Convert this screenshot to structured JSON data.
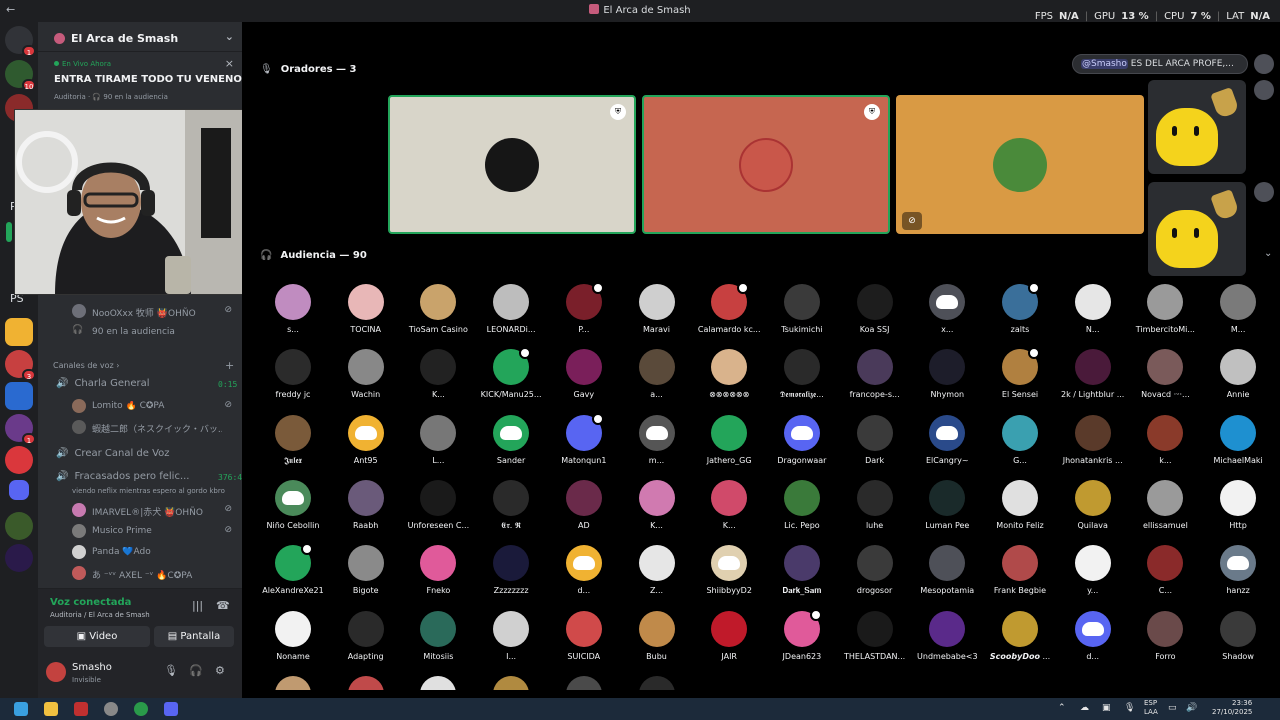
{
  "window": {
    "title": "El Arca de Smash",
    "back_icon": "arrow-left-icon"
  },
  "stats": {
    "fps_label": "FPS",
    "fps": "N/A",
    "gpu_label": "GPU",
    "gpu": "13 %",
    "cpu_label": "CPU",
    "cpu": "7 %",
    "lat_label": "LAT",
    "lat": "N/A"
  },
  "rail": {
    "badges": [
      "1",
      "10",
      "1",
      "3",
      "1"
    ],
    "ps_label": "PS",
    "pd_label": "PD"
  },
  "sidebar": {
    "server_name": "El Arca de Smash",
    "stage": {
      "live_label": "En Vivo Ahora",
      "title": "ENTRA TIRAME TODO TU VENENO",
      "sub": "Auditoria · 🎧 90 en la audiencia"
    },
    "stage_members": [
      {
        "name": "NooOXxx 牧师 👹OHÑO"
      },
      {
        "name": "90 en la audiencia"
      }
    ],
    "voice_category": "Canales de voz",
    "channels": [
      {
        "name": "Charla General",
        "time": "0:15",
        "members": [
          "Lomito 🔥 C✪PA",
          "蝦越二郎（ネスクイック・バッ..."
        ]
      },
      {
        "name": "Crear Canal de Voz"
      },
      {
        "name": "Fracasados pero felic...",
        "time": "376:49:39",
        "status": "viendo neflix mientras espero al gordo kbro",
        "members": [
          "IMARVEL®|赤犬 👹OHÑO",
          "Musico Prime",
          "Panda 💙Ado",
          "あ ⁻ᵛᵛ AXEL ⁻ᵛ 🔥C✪PA"
        ]
      }
    ],
    "voice": {
      "connected": "Voz conectada",
      "where": "Auditoria / El Arca de Smash",
      "video_label": "Video",
      "screen_label": "Pantalla"
    },
    "user": {
      "name": "Smasho",
      "status": "Invisible"
    }
  },
  "main": {
    "speakers_label": "Oradores — 3",
    "audience_label": "Audiencia — 90",
    "chat_mention": "@Smasho",
    "chat_text": " ES DEL ARCA PROFE,...",
    "speaker_tiles": [
      {
        "color": "#d8d5c9",
        "badge": true,
        "muted": false
      },
      {
        "color": "#c66650",
        "badge": true,
        "muted": false
      },
      {
        "color": "#d99a44",
        "badge": false,
        "muted": true
      }
    ],
    "audience": [
      "s...",
      "TOCINA",
      "TioSam Casino",
      "LEONARDi...",
      "P...",
      "Maravi",
      "Calamardo kc...",
      "Tsukimichi",
      "Koa SSJ",
      "x...",
      "zalts",
      "N...",
      "TimbercitoMi...",
      "M...",
      "freddy jc",
      "Wachin",
      "K...",
      "KICK/Manu25...",
      "Gavy",
      "a...",
      "⊗⊗⊗⊗⊗⊗",
      "𝕯𝖊𝖒𝖔𝖗𝖆𝖑𝖎𝖟𝖊...",
      "francope-s...",
      "Nhymon",
      "El Sensei",
      "2k / Lightblur ...",
      "Novacd ·ᵕ·...",
      "Annie",
      "𝕵𝖚𝖑𝖊𝖝",
      "Ant95",
      "L...",
      "Sander",
      "Matonqun1",
      "m...",
      "Jathero_GG",
      "Dragonwaar",
      "Dark",
      "ElCangry~",
      "G...",
      "Jhonatankris ...",
      "k...",
      "MichaelMaki",
      "Niño Cebollin",
      "Raabh",
      "Unforeseen C...",
      "𝕰𝖗. 𝕽",
      "AD",
      "K...",
      "K...",
      "Lic. Pepo",
      "luhe",
      "Luman Pee",
      "Monito Feliz",
      "Quilava",
      "ellissamuel",
      "Http",
      "AleXandreXe21",
      "Bigote",
      "Fneko",
      "Zzzzzzzz",
      "d...",
      "Z...",
      "ShiibbyyD2",
      "𝐃𝐚𝐫𝐤_𝐒𝐚𝐦",
      "drogosor",
      "Mesopotamia",
      "Frank Begbie",
      "y...",
      "C...",
      "hanzz",
      "Noname",
      "Adapting",
      "Mitosiis",
      "I...",
      "SUICIDA",
      "Bubu",
      "JAIR",
      "JDean623",
      "THELASTDAN...",
      "Undmebabe<3",
      "𝙎𝙘𝙤𝙤𝙗𝙮𝘿𝙤𝙤 ...",
      "d...",
      "Forro",
      "Shadow"
    ],
    "audience_colors": [
      "#c08cc0",
      "#e8b7b7",
      "#c9a36b",
      "#bdbdbd",
      "#7a1f2a",
      "#cfcfcf",
      "#c74040",
      "#3a3a3a",
      "#1d1d1d",
      "#4e5058",
      "#3a6f9a",
      "#e6e6e6",
      "#9a9a9a",
      "#7a7a7a",
      "#2b2b2b",
      "#888",
      "#222",
      "#23a55a",
      "#7a1f5a",
      "#5a4a3a",
      "#d9b38c",
      "#2a2a2a",
      "#4a3a5a",
      "#1d1d2a",
      "#b08040",
      "#4a1a3a",
      "#7a5a5a",
      "#c0c0c0",
      "#7a5a3a",
      "#f0b232",
      "#777",
      "#23a55a",
      "#5865f2",
      "#555",
      "#23a55a",
      "#5865f2",
      "#3a3a3a",
      "#2a4a8a",
      "#3aa0b0",
      "#5a3a2a",
      "#8a3a2a",
      "#1e90d0",
      "#4a8a5a",
      "#6a5a7a",
      "#1a1a1a",
      "#2a2a2a",
      "#6a2a4a",
      "#d07ab0",
      "#d04a6a",
      "#3a7a3a",
      "#2a2a2a",
      "#1a2a2a",
      "#e0e0e0",
      "#c09a30",
      "#9a9a9a",
      "#f2f2f2",
      "#23a55a",
      "#8a8a8a",
      "#e05a9a",
      "#1a1a3a",
      "#f0b232",
      "#e6e6e6",
      "#e0d0b0",
      "#4a3a6a",
      "#3a3a3a",
      "#4e5058",
      "#b04a4a",
      "#f2f2f2",
      "#8a2a2a",
      "#6a7a8a",
      "#f2f2f2",
      "#2a2a2a",
      "#2a6a5a",
      "#d0d0d0",
      "#d04a4a",
      "#c08a4a",
      "#c01a2a",
      "#e05a9a",
      "#1a1a1a",
      "#5a2a8a",
      "#c09a30",
      "#5865f2",
      "#6a4a4a",
      "#3a3a3a"
    ],
    "audience_discord_default": [
      9,
      29,
      31,
      33,
      35,
      37,
      42,
      60,
      62,
      69,
      81
    ],
    "audience_mods": [
      4,
      6,
      10,
      17,
      24,
      32,
      56,
      77
    ],
    "audience_bottom_colors": [
      "#c09a70",
      "#c04a4a",
      "#e0e0e0",
      "#b08a40",
      "#4a4a4a",
      "#2a2a2a"
    ]
  },
  "taskbar": {
    "lang": "ESP",
    "lang2": "LAA",
    "time": "23:36",
    "date": "27/10/2025"
  }
}
